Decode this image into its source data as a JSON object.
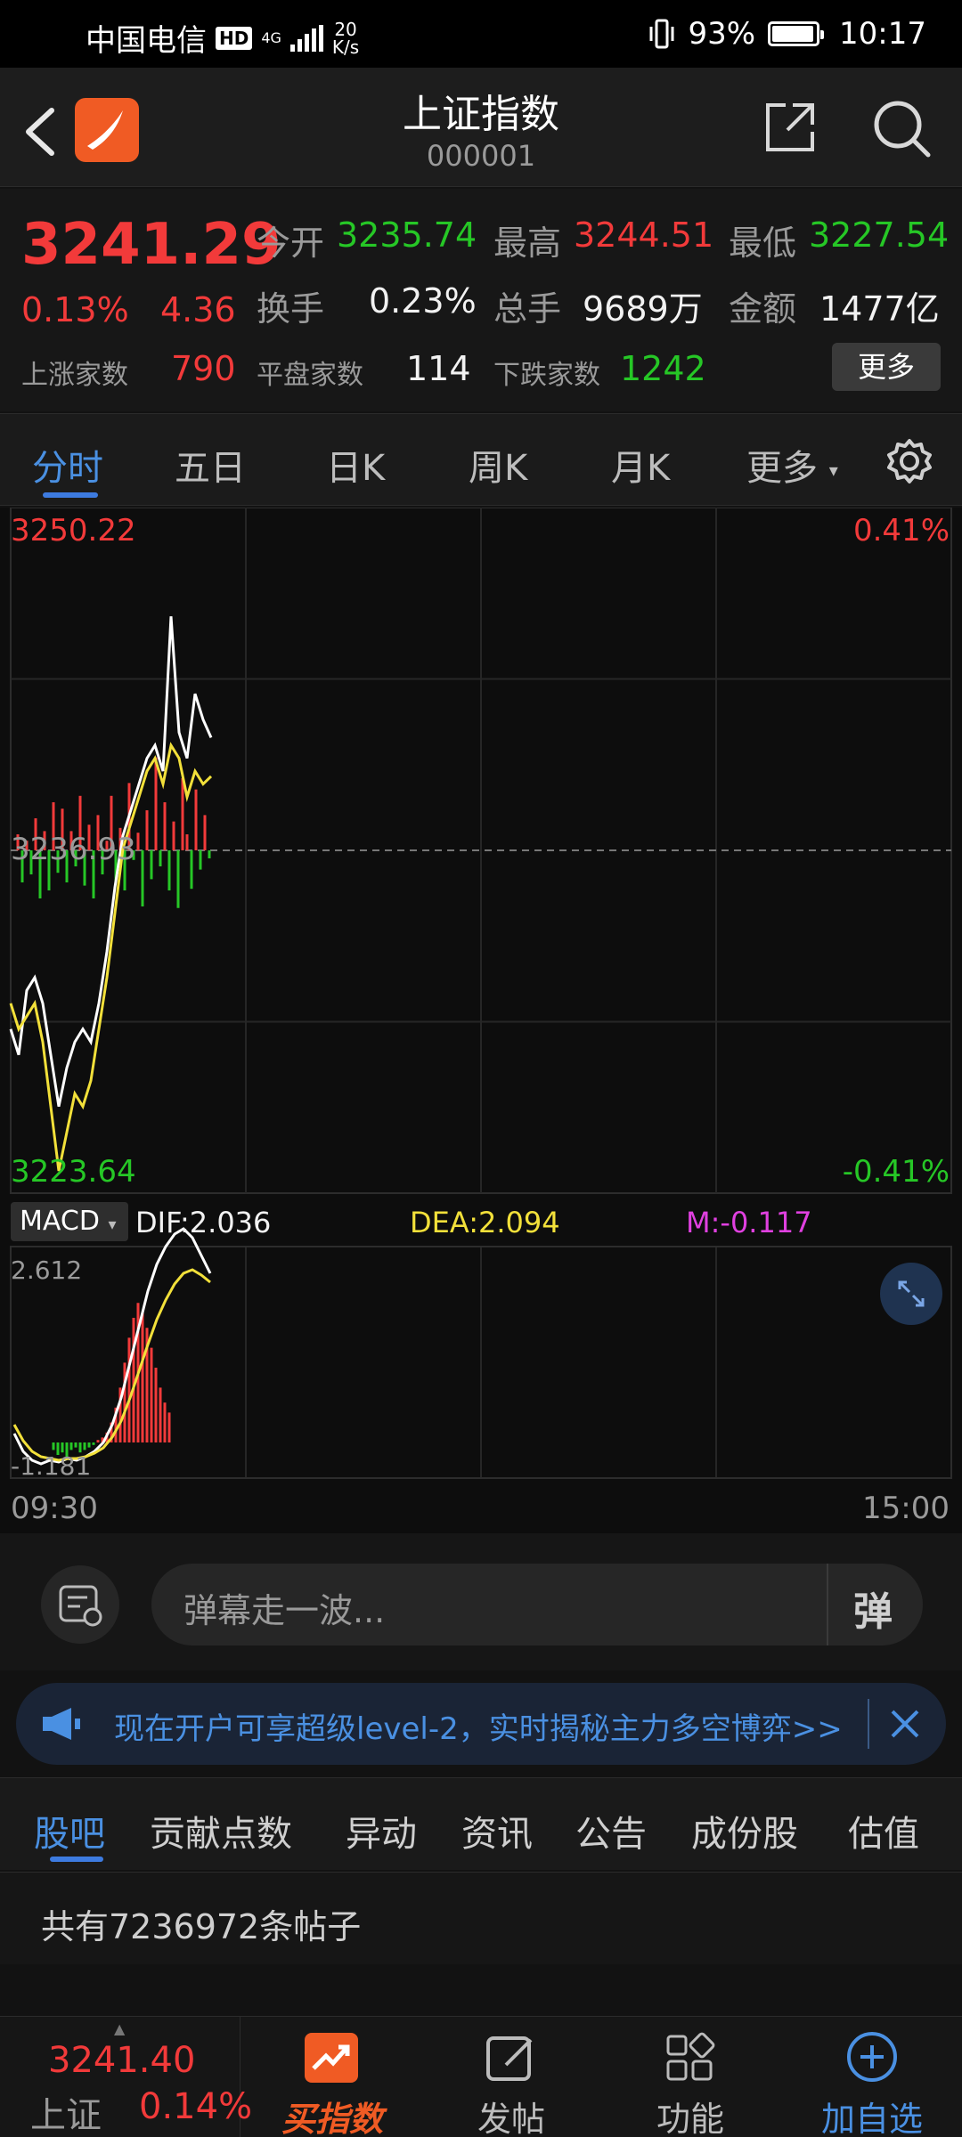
{
  "status_bar": {
    "carrier": "中国电信",
    "hd": "HD",
    "net_label": "4G",
    "net_speed_value": "20",
    "net_speed_unit": "K/s",
    "battery": "93%",
    "time": "10:17"
  },
  "header": {
    "title": "上证指数",
    "code": "000001"
  },
  "quote": {
    "price": "3241.29",
    "change_pct": "0.13%",
    "change_value": "4.36",
    "open_label": "今开",
    "open_value": "3235.74",
    "high_label": "最高",
    "high_value": "3244.51",
    "low_label": "最低",
    "low_value": "3227.54",
    "turnover_label": "换手",
    "turnover_value": "0.23%",
    "volume_label": "总手",
    "volume_value": "9689万",
    "amount_label": "金额",
    "amount_value": "1477亿",
    "up_label": "上涨家数",
    "up_value": "790",
    "flat_label": "平盘家数",
    "flat_value": "114",
    "down_label": "下跌家数",
    "down_value": "1242",
    "more_button": "更多"
  },
  "tabs": {
    "items": [
      "分时",
      "五日",
      "日K",
      "周K",
      "月K",
      "更多"
    ],
    "active": "分时"
  },
  "chart": {
    "top_price": "3250.22",
    "top_pct": "0.41%",
    "mid_price": "3236.93",
    "bottom_price": "3223.64",
    "bottom_pct": "-0.41%",
    "indicator_select": "MACD",
    "dif_label": "DIF:2.036",
    "dea_label": "DEA:2.094",
    "m_label": "M:-0.117",
    "macd_top": "2.612",
    "macd_bottom": "-1.181",
    "time_start": "09:30",
    "time_end": "15:00",
    "colors": {
      "up": "#f23a3a",
      "down": "#26c726",
      "price_line": "#ffffff",
      "avg_line": "#f2e03a",
      "m_color": "#e040e0"
    }
  },
  "danmu": {
    "placeholder": "弹幕走一波...",
    "button": "弹"
  },
  "banner": {
    "text": "现在开户可享超级level-2，实时揭秘主力多空博弈>>"
  },
  "sub_tabs": {
    "items": [
      "股吧",
      "贡献点数",
      "异动",
      "资讯",
      "公告",
      "成份股",
      "估值"
    ],
    "active": "股吧"
  },
  "posts": {
    "count_text": "共有7236972条帖子"
  },
  "bottom_nav": {
    "index_price": "3241.40",
    "index_name": "上证",
    "index_pct": "0.14%",
    "buy_index": "买指数",
    "post": "发帖",
    "functions": "功能",
    "add_watch": "加自选"
  },
  "chart_data": {
    "type": "line",
    "x_range": [
      "09:30",
      "15:00"
    ],
    "ylim": [
      3223.64,
      3250.22
    ],
    "baseline": 3236.93,
    "series": [
      {
        "values": [
          3230.0,
          3229.0,
          3231.5,
          3232.0,
          3231.0,
          3229.0,
          3227.0,
          3228.5,
          3229.5,
          3230.0,
          3229.5,
          3231.0,
          3233.0,
          3235.5,
          3237.5,
          3238.5,
          3239.5,
          3240.5,
          3241.0,
          3240.0,
          3246.0,
          3241.5,
          3240.5,
          3243.0,
          3242.0,
          3241.3
        ]
      },
      {
        "values": [
          3231.0,
          3230.0,
          3230.5,
          3231.0,
          3229.5,
          3227.0,
          3224.5,
          3226.0,
          3227.5,
          3227.0,
          3228.0,
          3230.0,
          3232.0,
          3234.5,
          3237.0,
          3238.0,
          3239.0,
          3240.0,
          3240.5,
          3239.5,
          3241.0,
          3240.5,
          3239.0,
          3240.0,
          3239.5,
          3239.8
        ]
      }
    ]
  }
}
